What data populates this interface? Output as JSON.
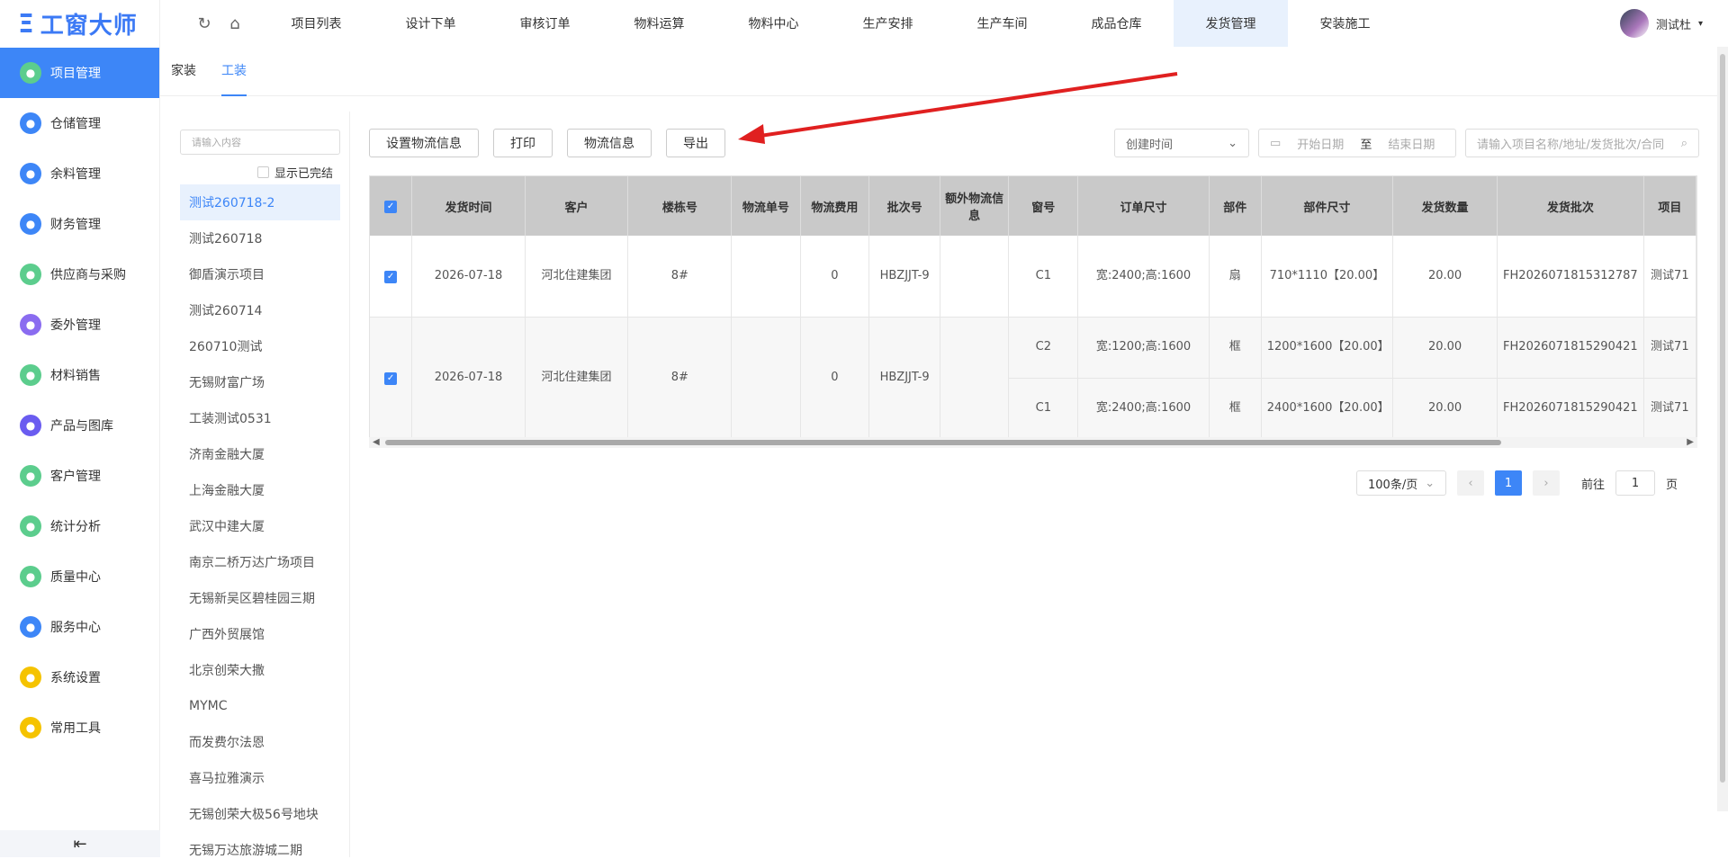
{
  "app": {
    "logo": "工窗大师"
  },
  "sidebar": {
    "items": [
      {
        "label": "项目管理",
        "color": "#5ccd8d",
        "active": true
      },
      {
        "label": "仓储管理",
        "color": "#3d86f7"
      },
      {
        "label": "余料管理",
        "color": "#3d86f7"
      },
      {
        "label": "财务管理",
        "color": "#3d86f7"
      },
      {
        "label": "供应商与采购",
        "color": "#5ccd8d"
      },
      {
        "label": "委外管理",
        "color": "#8a6cf0"
      },
      {
        "label": "材料销售",
        "color": "#5ccd8d"
      },
      {
        "label": "产品与图库",
        "color": "#6a5cf0"
      },
      {
        "label": "客户管理",
        "color": "#5ccd8d"
      },
      {
        "label": "统计分析",
        "color": "#5ccd8d"
      },
      {
        "label": "质量中心",
        "color": "#5ccd8d"
      },
      {
        "label": "服务中心",
        "color": "#3d86f7"
      },
      {
        "label": "系统设置",
        "color": "#f5c300"
      },
      {
        "label": "常用工具",
        "color": "#f5c300"
      }
    ]
  },
  "topnav": {
    "items": [
      "项目列表",
      "设计下单",
      "审核订单",
      "物料运算",
      "物料中心",
      "生产安排",
      "生产车间",
      "成品仓库",
      "发货管理",
      "安装施工"
    ],
    "active_index": 8,
    "user": "测试杜"
  },
  "subtabs": [
    "家装",
    "工装"
  ],
  "leftpanel": {
    "search_placeholder": "请输入内容",
    "show_done": "显示已完结",
    "projects": [
      "测试260718-2",
      "测试260718",
      "御盾演示项目",
      "测试260714",
      "260710测试",
      "无锡财富广场",
      "工装测试0531",
      "济南金融大厦",
      "上海金融大厦",
      "武汉中建大厦",
      "南京二桥万达广场项目",
      "无锡新吴区碧桂园三期",
      "广西外贸展馆",
      "北京创荣大撒",
      "MYMC",
      "而发费尔法恩",
      "喜马拉雅演示",
      "无锡创荣大极56号地块",
      "无锡万达旅游城二期"
    ]
  },
  "toolbar": {
    "set_logistics": "设置物流信息",
    "print": "打印",
    "logistics": "物流信息",
    "export": "导出"
  },
  "filters": {
    "time_type": "创建时间",
    "start_date": "开始日期",
    "to": "至",
    "end_date": "结束日期",
    "search_placeholder": "请输入项目名称/地址/发货批次/合同"
  },
  "table": {
    "headers": [
      "发货时间",
      "客户",
      "楼栋号",
      "物流单号",
      "物流费用",
      "批次号",
      "额外物流信息",
      "窗号",
      "订单尺寸",
      "部件",
      "部件尺寸",
      "发货数量",
      "发货批次",
      "项目"
    ],
    "rows": [
      {
        "time": "2026-07-18",
        "customer": "河北住建集团",
        "building": "8#",
        "tracking": "",
        "fee": "0",
        "batch": "HBZJJT-9",
        "extra": "",
        "sub": [
          {
            "window": "C1",
            "size": "宽:2400;高:1600",
            "part": "扇",
            "part_size": "710*1110【20.00】",
            "qty": "20.00",
            "ship_batch": "FH2026071815312787",
            "project": "测试71"
          }
        ]
      },
      {
        "time": "2026-07-18",
        "customer": "河北住建集团",
        "building": "8#",
        "tracking": "",
        "fee": "0",
        "batch": "HBZJJT-9",
        "extra": "",
        "sub": [
          {
            "window": "C2",
            "size": "宽:1200;高:1600",
            "part": "框",
            "part_size": "1200*1600【20.00】",
            "qty": "20.00",
            "ship_batch": "FH2026071815290421",
            "project": "测试71"
          },
          {
            "window": "C1",
            "size": "宽:2400;高:1600",
            "part": "框",
            "part_size": "2400*1600【20.00】",
            "qty": "20.00",
            "ship_batch": "FH2026071815290421",
            "project": "测试71"
          }
        ]
      }
    ]
  },
  "pager": {
    "per_page": "100条/页",
    "current": "1",
    "goto_label": "前往",
    "goto_value": "1",
    "page_suffix": "页"
  }
}
